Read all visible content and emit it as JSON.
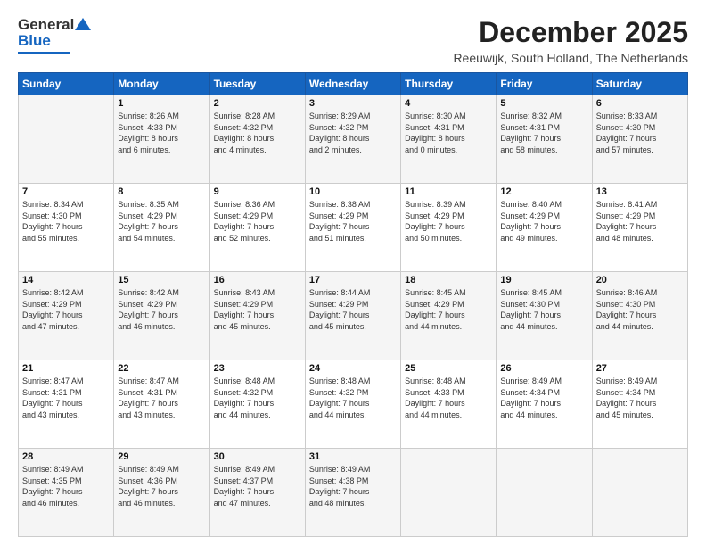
{
  "logo": {
    "line1": "General",
    "line2": "Blue"
  },
  "title": {
    "month_year": "December 2025",
    "location": "Reeuwijk, South Holland, The Netherlands"
  },
  "weekdays": [
    "Sunday",
    "Monday",
    "Tuesday",
    "Wednesday",
    "Thursday",
    "Friday",
    "Saturday"
  ],
  "weeks": [
    [
      {
        "day": "",
        "info": ""
      },
      {
        "day": "1",
        "info": "Sunrise: 8:26 AM\nSunset: 4:33 PM\nDaylight: 8 hours\nand 6 minutes."
      },
      {
        "day": "2",
        "info": "Sunrise: 8:28 AM\nSunset: 4:32 PM\nDaylight: 8 hours\nand 4 minutes."
      },
      {
        "day": "3",
        "info": "Sunrise: 8:29 AM\nSunset: 4:32 PM\nDaylight: 8 hours\nand 2 minutes."
      },
      {
        "day": "4",
        "info": "Sunrise: 8:30 AM\nSunset: 4:31 PM\nDaylight: 8 hours\nand 0 minutes."
      },
      {
        "day": "5",
        "info": "Sunrise: 8:32 AM\nSunset: 4:31 PM\nDaylight: 7 hours\nand 58 minutes."
      },
      {
        "day": "6",
        "info": "Sunrise: 8:33 AM\nSunset: 4:30 PM\nDaylight: 7 hours\nand 57 minutes."
      }
    ],
    [
      {
        "day": "7",
        "info": "Sunrise: 8:34 AM\nSunset: 4:30 PM\nDaylight: 7 hours\nand 55 minutes."
      },
      {
        "day": "8",
        "info": "Sunrise: 8:35 AM\nSunset: 4:29 PM\nDaylight: 7 hours\nand 54 minutes."
      },
      {
        "day": "9",
        "info": "Sunrise: 8:36 AM\nSunset: 4:29 PM\nDaylight: 7 hours\nand 52 minutes."
      },
      {
        "day": "10",
        "info": "Sunrise: 8:38 AM\nSunset: 4:29 PM\nDaylight: 7 hours\nand 51 minutes."
      },
      {
        "day": "11",
        "info": "Sunrise: 8:39 AM\nSunset: 4:29 PM\nDaylight: 7 hours\nand 50 minutes."
      },
      {
        "day": "12",
        "info": "Sunrise: 8:40 AM\nSunset: 4:29 PM\nDaylight: 7 hours\nand 49 minutes."
      },
      {
        "day": "13",
        "info": "Sunrise: 8:41 AM\nSunset: 4:29 PM\nDaylight: 7 hours\nand 48 minutes."
      }
    ],
    [
      {
        "day": "14",
        "info": "Sunrise: 8:42 AM\nSunset: 4:29 PM\nDaylight: 7 hours\nand 47 minutes."
      },
      {
        "day": "15",
        "info": "Sunrise: 8:42 AM\nSunset: 4:29 PM\nDaylight: 7 hours\nand 46 minutes."
      },
      {
        "day": "16",
        "info": "Sunrise: 8:43 AM\nSunset: 4:29 PM\nDaylight: 7 hours\nand 45 minutes."
      },
      {
        "day": "17",
        "info": "Sunrise: 8:44 AM\nSunset: 4:29 PM\nDaylight: 7 hours\nand 45 minutes."
      },
      {
        "day": "18",
        "info": "Sunrise: 8:45 AM\nSunset: 4:29 PM\nDaylight: 7 hours\nand 44 minutes."
      },
      {
        "day": "19",
        "info": "Sunrise: 8:45 AM\nSunset: 4:30 PM\nDaylight: 7 hours\nand 44 minutes."
      },
      {
        "day": "20",
        "info": "Sunrise: 8:46 AM\nSunset: 4:30 PM\nDaylight: 7 hours\nand 44 minutes."
      }
    ],
    [
      {
        "day": "21",
        "info": "Sunrise: 8:47 AM\nSunset: 4:31 PM\nDaylight: 7 hours\nand 43 minutes."
      },
      {
        "day": "22",
        "info": "Sunrise: 8:47 AM\nSunset: 4:31 PM\nDaylight: 7 hours\nand 43 minutes."
      },
      {
        "day": "23",
        "info": "Sunrise: 8:48 AM\nSunset: 4:32 PM\nDaylight: 7 hours\nand 44 minutes."
      },
      {
        "day": "24",
        "info": "Sunrise: 8:48 AM\nSunset: 4:32 PM\nDaylight: 7 hours\nand 44 minutes."
      },
      {
        "day": "25",
        "info": "Sunrise: 8:48 AM\nSunset: 4:33 PM\nDaylight: 7 hours\nand 44 minutes."
      },
      {
        "day": "26",
        "info": "Sunrise: 8:49 AM\nSunset: 4:34 PM\nDaylight: 7 hours\nand 44 minutes."
      },
      {
        "day": "27",
        "info": "Sunrise: 8:49 AM\nSunset: 4:34 PM\nDaylight: 7 hours\nand 45 minutes."
      }
    ],
    [
      {
        "day": "28",
        "info": "Sunrise: 8:49 AM\nSunset: 4:35 PM\nDaylight: 7 hours\nand 46 minutes."
      },
      {
        "day": "29",
        "info": "Sunrise: 8:49 AM\nSunset: 4:36 PM\nDaylight: 7 hours\nand 46 minutes."
      },
      {
        "day": "30",
        "info": "Sunrise: 8:49 AM\nSunset: 4:37 PM\nDaylight: 7 hours\nand 47 minutes."
      },
      {
        "day": "31",
        "info": "Sunrise: 8:49 AM\nSunset: 4:38 PM\nDaylight: 7 hours\nand 48 minutes."
      },
      {
        "day": "",
        "info": ""
      },
      {
        "day": "",
        "info": ""
      },
      {
        "day": "",
        "info": ""
      }
    ]
  ]
}
